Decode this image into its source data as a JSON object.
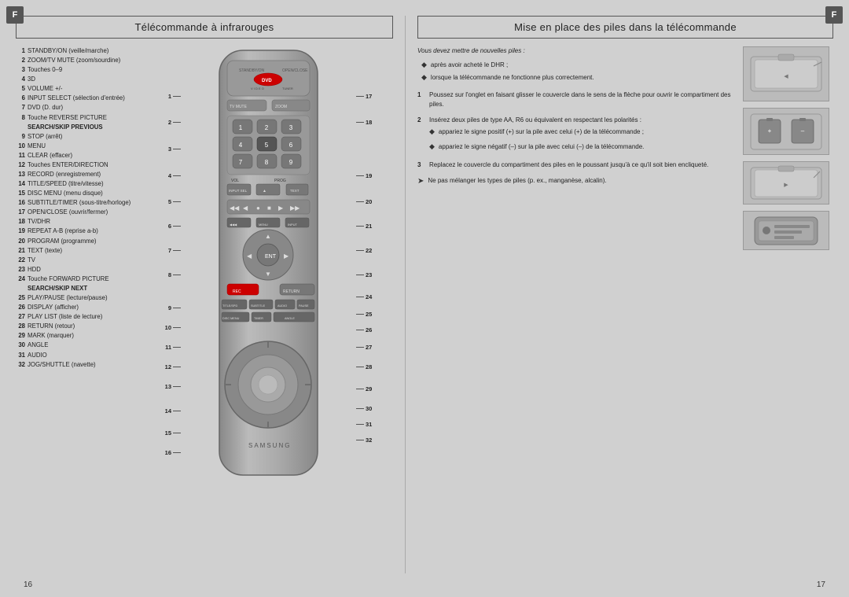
{
  "page": {
    "left_title": "Télécommande à infrarouges",
    "right_title": "Mise en place des piles dans la télécommande",
    "corner_label": "F",
    "page_left": "16",
    "page_right": "17"
  },
  "numbered_items": [
    {
      "num": "1",
      "text": "STANDBY/ON (veille/marche)"
    },
    {
      "num": "2",
      "text": "ZOOM/TV MUTE (zoom/sourdine)"
    },
    {
      "num": "3",
      "text": "Touches 0–9"
    },
    {
      "num": "4",
      "text": "3D"
    },
    {
      "num": "5",
      "text": "VOLUME +/-"
    },
    {
      "num": "6",
      "text": "INPUT SELECT (sélection d'entrée)"
    },
    {
      "num": "7",
      "text": "DVD (D. dur)"
    },
    {
      "num": "8",
      "text": "Touche REVERSE PICTURE",
      "bold_extra": "SEARCH/SKIP PREVIOUS"
    },
    {
      "num": "9",
      "text": "STOP (arrêt)"
    },
    {
      "num": "10",
      "text": "MENU"
    },
    {
      "num": "11",
      "text": "CLEAR (effacer)"
    },
    {
      "num": "12",
      "text": "Touches ENTER/DIRECTION"
    },
    {
      "num": "13",
      "text": "RECORD (enregistrement)"
    },
    {
      "num": "14",
      "text": "TITLE/SPEED (titre/vitesse)"
    },
    {
      "num": "15",
      "text": "DISC MENU (menu disque)"
    },
    {
      "num": "16",
      "text": "SUBTITLE/TIMER (sous-titre/horloge)"
    },
    {
      "num": "17",
      "text": "OPEN/CLOSE (ouvrir/fermer)"
    },
    {
      "num": "18",
      "text": "TV/DHR"
    },
    {
      "num": "19",
      "text": "REPEAT A-B (reprise a-b)"
    },
    {
      "num": "20",
      "text": "PROGRAM (programme)"
    },
    {
      "num": "21",
      "text": "TEXT (texte)"
    },
    {
      "num": "22",
      "text": "TV"
    },
    {
      "num": "23",
      "text": "HDD"
    },
    {
      "num": "24",
      "text": "Touche FORWARD PICTURE",
      "bold_extra": "SEARCH/SKIP NEXT"
    },
    {
      "num": "25",
      "text": "PLAY/PAUSE (lecture/pause)"
    },
    {
      "num": "26",
      "text": "DISPLAY (afficher)"
    },
    {
      "num": "27",
      "text": "PLAY LIST (liste de lecture)"
    },
    {
      "num": "28",
      "text": "RETURN (retour)"
    },
    {
      "num": "29",
      "text": "MARK (marquer)"
    },
    {
      "num": "30",
      "text": "ANGLE"
    },
    {
      "num": "31",
      "text": "AUDIO"
    },
    {
      "num": "32",
      "text": "JOG/SHUTTLE (navette)"
    }
  ],
  "battery_instructions": {
    "intro": "Vous devez mettre de nouvelles piles :",
    "bullets": [
      "après avoir acheté le DHR ;",
      "lorsque la télécommande ne fonctionne plus correctement."
    ],
    "steps": [
      {
        "num": "1",
        "text": "Poussez sur l'onglet en faisant glisser le couvercle dans le sens de la flèche pour ouvrir le compartiment des piles."
      },
      {
        "num": "2",
        "text": "Insérez deux piles de type AA, R6 ou équivalent en respectant les polarités :",
        "sub_bullets": [
          "appariez le signe positif (+) sur la pile avec celui (+) de la télécommande ;",
          "appariez le signe négatif (–) sur la pile avec celui (–) de la télécommande."
        ]
      },
      {
        "num": "3",
        "text": "Replacez le couvercle du compartiment des piles en le poussant jusqu'à ce qu'il soit bien encliqueté."
      }
    ],
    "warning": "Ne pas mélanger les types de piles (p. ex., manganèse, alcalin)."
  },
  "callouts_left": [
    {
      "num": "1",
      "top_pct": 10.5
    },
    {
      "num": "2",
      "top_pct": 16
    },
    {
      "num": "3",
      "top_pct": 22
    },
    {
      "num": "4",
      "top_pct": 29
    },
    {
      "num": "5",
      "top_pct": 35.5
    },
    {
      "num": "6",
      "top_pct": 42
    },
    {
      "num": "7",
      "top_pct": 48
    },
    {
      "num": "8",
      "top_pct": 55
    },
    {
      "num": "9",
      "top_pct": 60
    },
    {
      "num": "10",
      "top_pct": 64
    },
    {
      "num": "11",
      "top_pct": 68
    },
    {
      "num": "12",
      "top_pct": 73
    },
    {
      "num": "13",
      "top_pct": 78
    },
    {
      "num": "14",
      "top_pct": 84
    },
    {
      "num": "15",
      "top_pct": 88
    },
    {
      "num": "16",
      "top_pct": 93
    }
  ],
  "callouts_right": [
    {
      "num": "17",
      "top_pct": 10.5
    },
    {
      "num": "18",
      "top_pct": 16
    },
    {
      "num": "19",
      "top_pct": 29
    },
    {
      "num": "20",
      "top_pct": 35.5
    },
    {
      "num": "21",
      "top_pct": 42
    },
    {
      "num": "22",
      "top_pct": 48
    },
    {
      "num": "23",
      "top_pct": 55
    },
    {
      "num": "24",
      "top_pct": 60
    },
    {
      "num": "25",
      "top_pct": 64
    },
    {
      "num": "26",
      "top_pct": 68
    },
    {
      "num": "27",
      "top_pct": 73
    },
    {
      "num": "28",
      "top_pct": 78
    },
    {
      "num": "29",
      "top_pct": 84
    },
    {
      "num": "30",
      "top_pct": 88
    },
    {
      "num": "31",
      "top_pct": 91
    },
    {
      "num": "32",
      "top_pct": 95
    }
  ]
}
